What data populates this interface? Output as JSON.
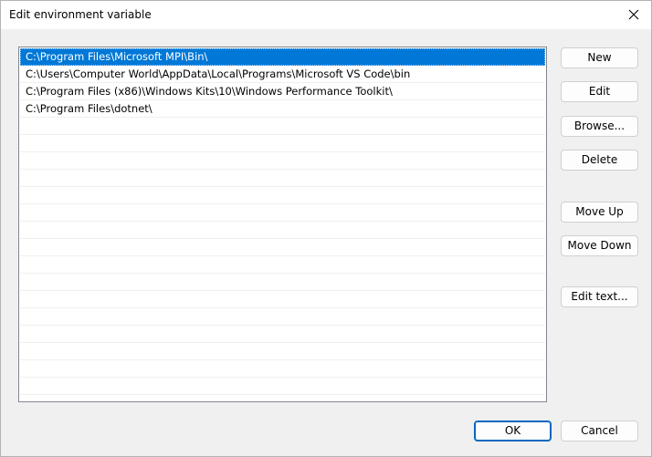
{
  "window": {
    "title": "Edit environment variable",
    "close_icon": "close-icon"
  },
  "paths": [
    "C:\\Program Files\\Microsoft MPI\\Bin\\",
    "C:\\Users\\Computer World\\AppData\\Local\\Programs\\Microsoft VS Code\\bin",
    "C:\\Program Files (x86)\\Windows Kits\\10\\Windows Performance Toolkit\\",
    "C:\\Program Files\\dotnet\\"
  ],
  "selected_index": 0,
  "buttons": {
    "new": "New",
    "edit": "Edit",
    "browse": "Browse...",
    "delete": "Delete",
    "move_up": "Move Up",
    "move_down": "Move Down",
    "edit_text": "Edit text..."
  },
  "footer": {
    "ok": "OK",
    "cancel": "Cancel"
  },
  "colors": {
    "selection": "#0078d7",
    "ok_border": "#0067c0"
  }
}
